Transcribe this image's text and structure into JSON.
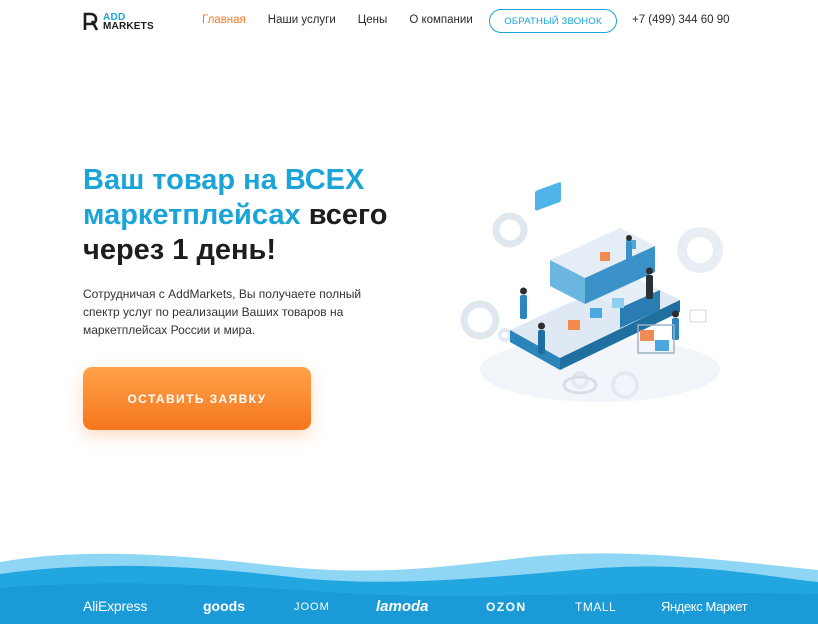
{
  "header": {
    "logo": {
      "line1": "ADD",
      "line2": "MARKETS"
    },
    "nav": [
      {
        "label": "Главная",
        "active": true
      },
      {
        "label": "Наши услуги",
        "active": false
      },
      {
        "label": "Цены",
        "active": false
      },
      {
        "label": "О компании",
        "active": false
      }
    ],
    "callback_label": "ОБРАТНЫЙ ЗВОНОК",
    "phone": "+7 (499) 344 60 90"
  },
  "hero": {
    "headline_blue_1": "Ваш товар на ВСЕХ",
    "headline_blue_2": "маркетплейсах",
    "headline_dark_1": " всего",
    "headline_dark_2": "через 1 день!",
    "lead": "Сотрудничая с AddMarkets, Вы получаете полный спектр услуг по реализации Ваших товаров на маркетплейсах России и мира.",
    "cta_label": "ОСТАВИТЬ ЗАЯВКУ"
  },
  "marketplaces": [
    "AliExpress",
    "goods",
    "JOOM",
    "lamoda",
    "OZON",
    "TMALL",
    "Яндекс Маркет"
  ],
  "colors": {
    "accent_blue": "#1aa4d8",
    "accent_orange": "#f5761d",
    "active_nav": "#ef7b2f"
  }
}
